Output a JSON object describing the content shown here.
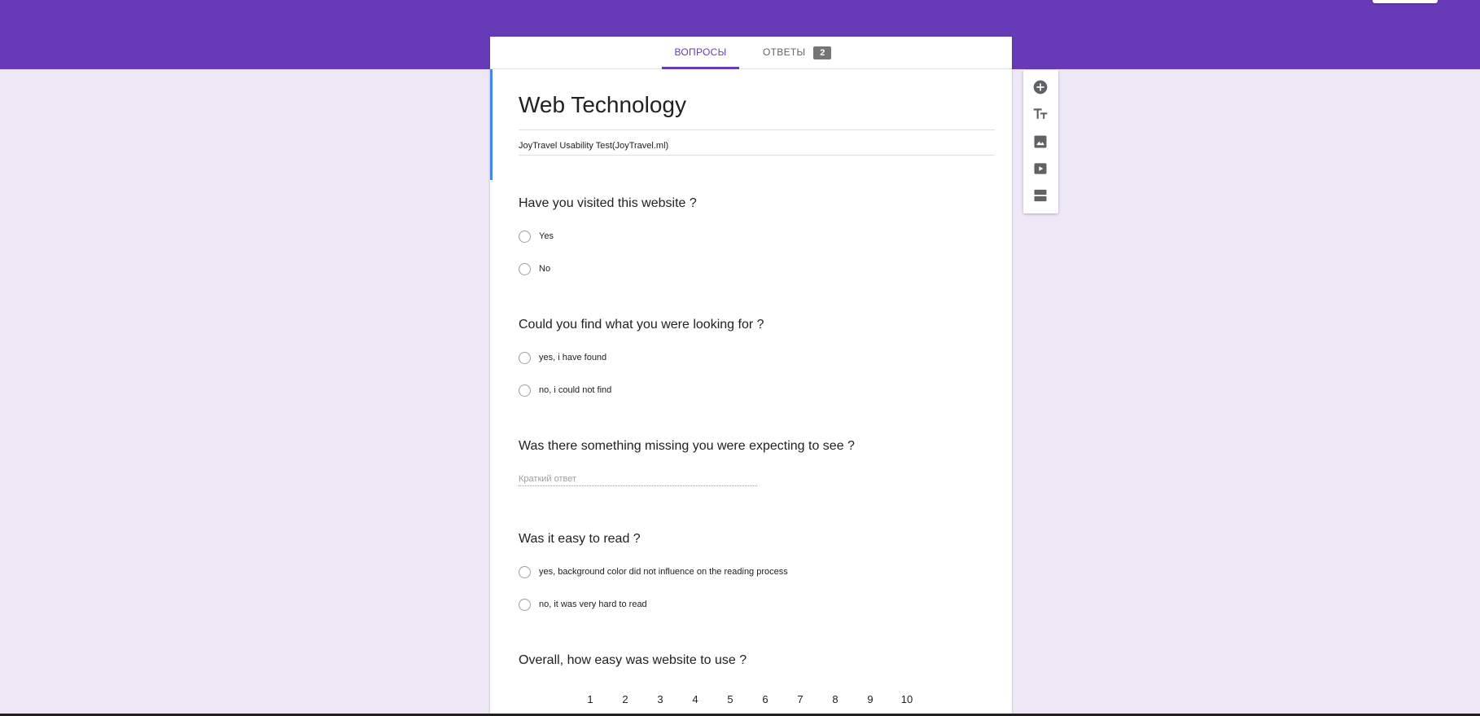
{
  "tabs": {
    "questions_label": "ВОПРОСЫ",
    "responses_label": "ОТВЕТЫ",
    "responses_count": "2"
  },
  "form": {
    "title": "Web Technology",
    "description": "JoyTravel Usability Test(JoyTravel.ml)"
  },
  "questions": [
    {
      "title": "Have you visited this website ?",
      "options": [
        "Yes",
        "No"
      ]
    },
    {
      "title": "Could you find what you were looking for ?",
      "options": [
        "yes, i have found",
        "no, i could not find"
      ]
    },
    {
      "title": "Was there something missing you were expecting to see ?",
      "placeholder": "Краткий ответ"
    },
    {
      "title": "Was it easy to read ?",
      "options": [
        "yes, background color did not influence on the reading process",
        "no, it was very hard to read"
      ]
    },
    {
      "title": "Overall, how easy was website to use ?",
      "scale": [
        "1",
        "2",
        "3",
        "4",
        "5",
        "6",
        "7",
        "8",
        "9",
        "10"
      ]
    }
  ],
  "toolbar": {
    "icons": [
      "add-question-icon",
      "add-title-icon",
      "add-image-icon",
      "add-video-icon",
      "add-section-icon"
    ]
  },
  "colors": {
    "theme": "#673ab7",
    "background": "#ede7f6",
    "focus": "#4285f4",
    "icon": "#5f6368"
  }
}
